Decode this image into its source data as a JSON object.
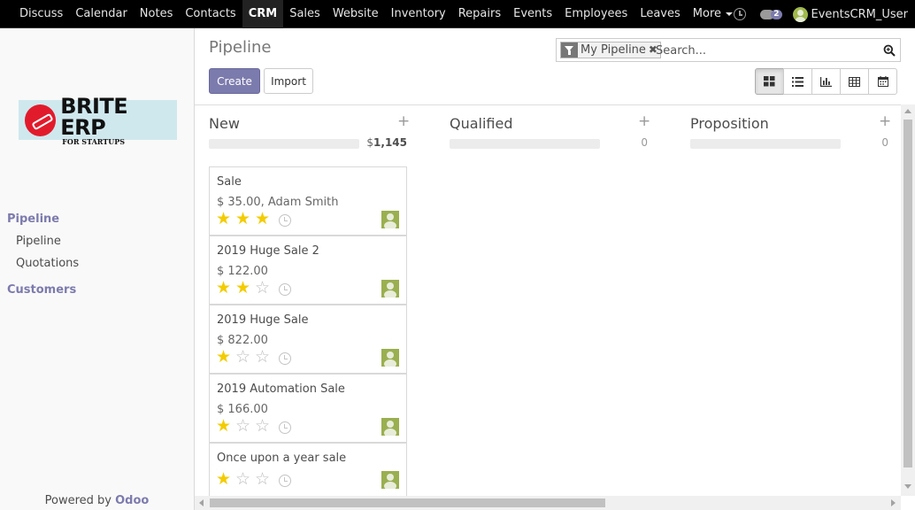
{
  "nav": {
    "items": [
      "Discuss",
      "Calendar",
      "Notes",
      "Contacts",
      "CRM",
      "Sales",
      "Website",
      "Inventory",
      "Repairs",
      "Events",
      "Employees",
      "Leaves"
    ],
    "active": "CRM",
    "more_label": "More",
    "chat_count": "2",
    "user_name": "EventsCRM_User"
  },
  "sidebar": {
    "logo_main": "BRITE ERP",
    "logo_sub": "FOR STARTUPS",
    "section_pipeline": "Pipeline",
    "links": [
      "Pipeline",
      "Quotations"
    ],
    "section_customers": "Customers",
    "powered_prefix": "Powered by",
    "powered_brand": "Odoo"
  },
  "control": {
    "breadcrumb": "Pipeline",
    "create_label": "Create",
    "import_label": "Import",
    "facet_label": "My Pipeline",
    "facet_close": "✖",
    "search_placeholder": "Search...",
    "active_view": "kanban"
  },
  "columns": [
    {
      "title": "New",
      "add": "+",
      "total_currency": "$",
      "total": "1,145",
      "cards": [
        {
          "title": "Sale",
          "subtitle": "$ 35.00, Adam Smith",
          "stars": 3
        },
        {
          "title": "2019 Huge Sale 2",
          "subtitle": "$ 122.00",
          "stars": 2
        },
        {
          "title": "2019 Huge Sale",
          "subtitle": "$ 822.00",
          "stars": 1
        },
        {
          "title": "2019 Automation Sale",
          "subtitle": "$ 166.00",
          "stars": 1
        },
        {
          "title": "Once upon a year sale",
          "subtitle": "",
          "stars": 1
        }
      ]
    },
    {
      "title": "Qualified",
      "add": "+",
      "total": "0",
      "cards": []
    },
    {
      "title": "Proposition",
      "add": "+",
      "total": "0",
      "cards": []
    }
  ],
  "colors": {
    "accent": "#7c7bad",
    "star_on": "#f3cc00",
    "star_off": "#bbbbbb",
    "avatar": "#9aaf50"
  }
}
